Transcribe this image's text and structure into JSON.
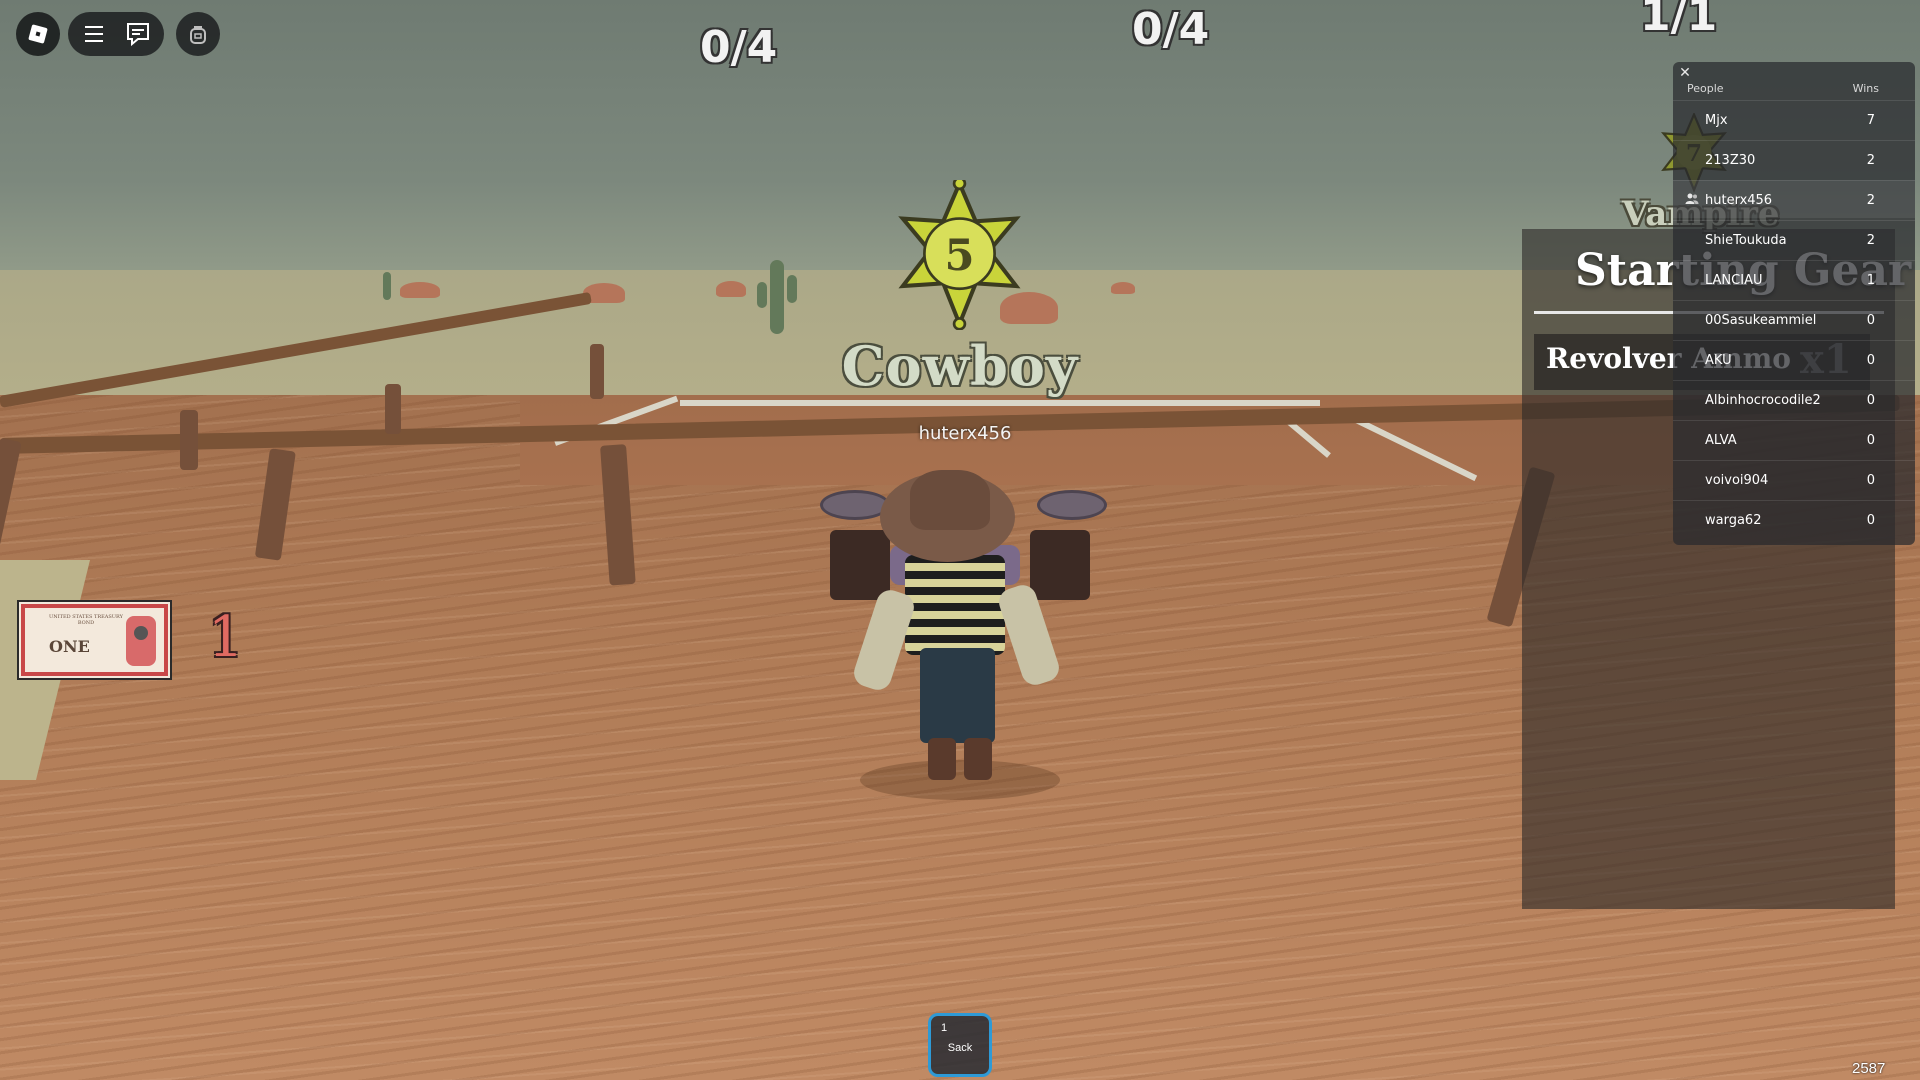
{
  "hud": {
    "scores": [
      "0/4",
      "0/4",
      "1/1"
    ],
    "class_badge_number": "5",
    "class_name": "Cowboy",
    "player_name": "huterx456",
    "bond_text": "ONE",
    "bond_fine_print": "UNITED STATES TREASURY BOND",
    "bond_count": "1",
    "vampire_badge_number": "7",
    "vampire_label": "Vampire",
    "counter": "2587"
  },
  "starting_gear": {
    "title": "Starting Gear",
    "items": [
      {
        "name": "Revolver Ammo",
        "qty": "x1"
      }
    ]
  },
  "leaderboard": {
    "close_label": "✕",
    "col_people": "People",
    "col_wins": "Wins",
    "rows": [
      {
        "name": "Mjx",
        "wins": "7"
      },
      {
        "name": "213Z30",
        "wins": "2"
      },
      {
        "name": "huterx456",
        "wins": "2"
      },
      {
        "name": "ShieToukuda",
        "wins": "2"
      },
      {
        "name": "LANCIAU",
        "wins": "1"
      },
      {
        "name": "00Sasukeammiel",
        "wins": "0"
      },
      {
        "name": "AKU",
        "wins": "0"
      },
      {
        "name": "Albinhocrocodile2",
        "wins": "0"
      },
      {
        "name": "ALVA",
        "wins": "0"
      },
      {
        "name": "voivoi904",
        "wins": "0"
      },
      {
        "name": "warga62",
        "wins": "0"
      }
    ]
  },
  "hotbar": {
    "slots": [
      {
        "key": "1",
        "label": "Sack"
      }
    ]
  },
  "icons": {
    "topbar": [
      "roblox-logo-icon",
      "menu-icon",
      "chat-icon",
      "backpack-icon"
    ],
    "leaderboard_self": "friends-icon"
  },
  "colors": {
    "badge_fill": "#c9d43a",
    "hotbar_accent": "#2e9ad6",
    "bond_count": "#e06a62"
  }
}
